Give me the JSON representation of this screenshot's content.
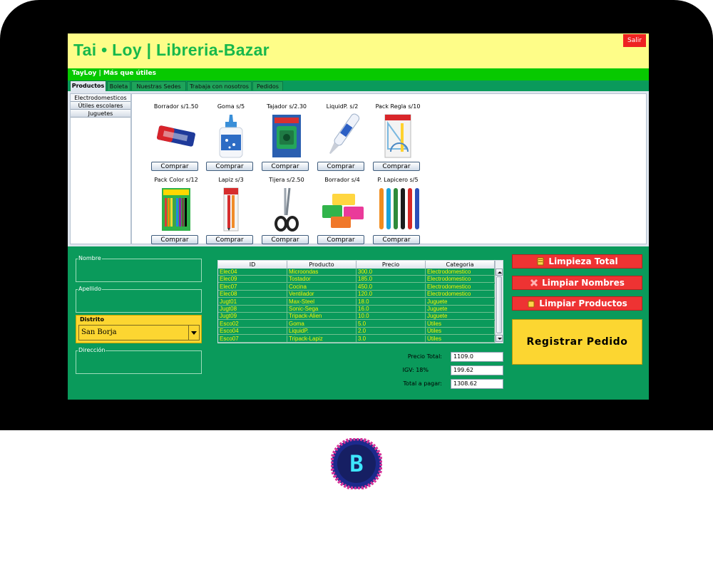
{
  "app": {
    "title": "Tai • Loy | Libreria-Bazar",
    "exit_label": "Salir",
    "slogan": "TayLoy | Más que útiles"
  },
  "tabs": [
    {
      "label": "Productos"
    },
    {
      "label": "Boleta"
    },
    {
      "label": "Nuestras Sedes"
    },
    {
      "label": "Trabaja con nosotros"
    },
    {
      "label": "Pedidos"
    }
  ],
  "categories": [
    {
      "label": "Electrodomesticos"
    },
    {
      "label": "Útiles escolares"
    },
    {
      "label": "Juguetes"
    }
  ],
  "buy_label": "Comprar",
  "products": [
    {
      "label": "Borrador s/1.50",
      "icon": "eraser-icon"
    },
    {
      "label": "Goma s/5",
      "icon": "glue-bottle-icon"
    },
    {
      "label": "Tajador s/2.30",
      "icon": "sharpener-icon"
    },
    {
      "label": "LiquidP. s/2",
      "icon": "correction-pen-icon"
    },
    {
      "label": "Pack Regla s/10",
      "icon": "ruler-pack-icon"
    },
    {
      "label": "Pack Color s/12",
      "icon": "color-pack-icon"
    },
    {
      "label": "Lapiz s/3",
      "icon": "pencil-pack-icon"
    },
    {
      "label": "Tijera s/2.50",
      "icon": "scissors-icon"
    },
    {
      "label": "Borrador s/4",
      "icon": "erasers-icon"
    },
    {
      "label": "P. Lapicero s/5",
      "icon": "pens-icon"
    }
  ],
  "form": {
    "nombre_label": "Nombre",
    "nombre_value": "",
    "apellido_label": "Apellido",
    "apellido_value": "",
    "distrito_label": "Distrito",
    "distrito_value": "San Borja",
    "direccion_label": "Dirección",
    "direccion_value": ""
  },
  "table": {
    "columns": [
      "ID",
      "Producto",
      "Precio",
      "Categoria"
    ],
    "rows": [
      [
        "Elec04",
        "Microondas",
        "300.0",
        "Electrodomestico"
      ],
      [
        "Elec09",
        "Tostador",
        "185.0",
        "Electrodomestico"
      ],
      [
        "Elec07",
        "Cocina",
        "450.0",
        "Electrodomestico"
      ],
      [
        "Elec08",
        "Ventilador",
        "120.0",
        "Electrodomestico"
      ],
      [
        "Jugt01",
        "Max-Steel",
        "18.0",
        "Juguete"
      ],
      [
        "Jugt08",
        "Sonic-Sega",
        "16.0",
        "Juguete"
      ],
      [
        "Jugt09",
        "Tripack-Alien",
        "10.0",
        "Juguete"
      ],
      [
        "Esco02",
        "Goma",
        "5.0",
        "Útiles"
      ],
      [
        "Esco04",
        "LiquidP.",
        "2.0",
        "Útiles"
      ],
      [
        "Esco07",
        "Tripack-Lapiz",
        "3.0",
        "Útiles"
      ]
    ]
  },
  "summary": {
    "precio_total_label": "Precio Total:",
    "precio_total_value": "1109.0",
    "igv_label": "IGV: 18%",
    "igv_value": "199.62",
    "total_label": "Total a pagar:",
    "total_value": "1308.62"
  },
  "actions": {
    "limpieza_total": "Limpieza Total",
    "limpiar_nombres": "Limpiar Nombres",
    "limpiar_productos": "Limpiar Productos",
    "registrar": "Registrar Pedido"
  },
  "colors": {
    "screen_bg": "#0a9a5b",
    "title_bar": "#fefd88",
    "title_text": "#17b84b",
    "slogan_bar": "#07c900",
    "danger": "#ee3333",
    "accent_yellow": "#fcd631",
    "table_text": "#f5f500"
  },
  "logo": {
    "letter": "B"
  }
}
